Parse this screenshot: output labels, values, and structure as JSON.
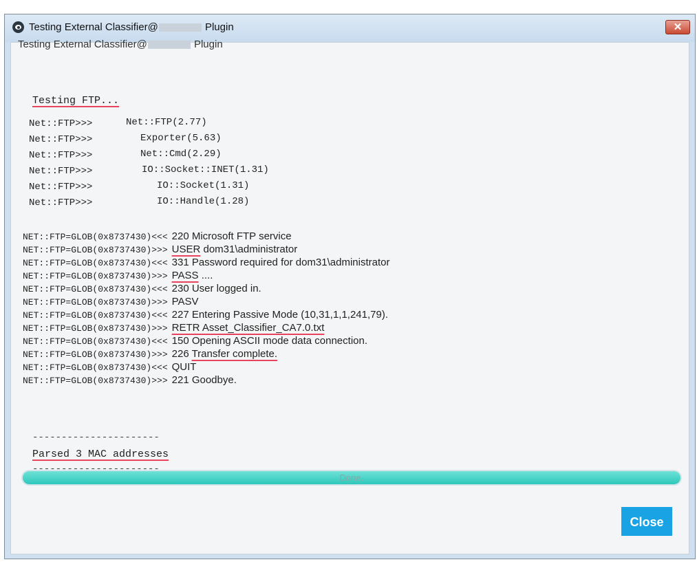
{
  "window": {
    "title_prefix": "Testing External Classifier@",
    "title_suffix": " Plugin",
    "close_glyph": "✕"
  },
  "header": {
    "prefix": "Testing External Classifier@",
    "suffix": " Plugin"
  },
  "testing_label": "Testing FTP...",
  "module_rows": [
    {
      "prefix": "Net::FTP>>>",
      "module": "Net::FTP(2.77)"
    },
    {
      "prefix": "Net::FTP>>>",
      "module": "Exporter(5.63)"
    },
    {
      "prefix": "Net::FTP>>>",
      "module": "Net::Cmd(2.29)"
    },
    {
      "prefix": "Net::FTP>>>",
      "module": "IO::Socket::INET(1.31)"
    },
    {
      "prefix": "Net::FTP>>>",
      "module": "IO::Socket(1.31)"
    },
    {
      "prefix": "Net::FTP>>>",
      "module": "IO::Handle(1.28)"
    }
  ],
  "log": [
    {
      "prefix": "NET::FTP=GLOB(0x8737430)<<<",
      "underlined": "",
      "message": "220  Microsoft FTP service"
    },
    {
      "prefix": "NET::FTP=GLOB(0x8737430)>>>",
      "underlined": "USER",
      "message": " dom31\\administrator"
    },
    {
      "prefix": "NET::FTP=GLOB(0x8737430)<<<",
      "underlined": "",
      "message": "331 Password required for dom31\\administrator"
    },
    {
      "prefix": "NET::FTP=GLOB(0x8737430)>>>",
      "underlined": "PASS",
      "message": " ...."
    },
    {
      "prefix": "NET::FTP=GLOB(0x8737430)<<<",
      "underlined": "",
      "message": "230 User logged in."
    },
    {
      "prefix": "NET::FTP=GLOB(0x8737430)>>>",
      "underlined": "",
      "message": "PASV"
    },
    {
      "prefix": "NET::FTP=GLOB(0x8737430)<<<",
      "underlined": "",
      "message": "227 Entering Passive Mode (10,31,1,1,241,79)."
    },
    {
      "prefix": "NET::FTP=GLOB(0x8737430)>>>",
      "underlined": "RETR Asset_Classifier_CA7.0.txt",
      "message": ""
    },
    {
      "prefix": "NET::FTP=GLOB(0x8737430)<<<",
      "underlined": "",
      "message": "150 Opening ASCII mode data connection."
    },
    {
      "prefix": "NET::FTP=GLOB(0x8737430)>>>",
      "underlined": "Transfer complete.",
      "message": "226 ",
      "underline_after": true
    },
    {
      "prefix": "NET::FTP=GLOB(0x8737430)<<<",
      "underlined": "",
      "message": "QUIT"
    },
    {
      "prefix": "NET::FTP=GLOB(0x8737430)>>>",
      "underlined": "",
      "message": "221 Goodbye."
    }
  ],
  "divider": "----------------------",
  "parsed_label": "Parsed 3 MAC addresses",
  "progress": {
    "label": "Done.",
    "fraction": 1.0
  },
  "buttons": {
    "close": "Close"
  }
}
